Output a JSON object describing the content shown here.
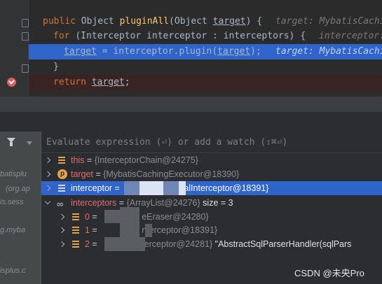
{
  "editor": {
    "lines": [
      {
        "id": "sig",
        "parts": [
          {
            "t": "public ",
            "c": "kw"
          },
          {
            "t": "Object ",
            "c": ""
          },
          {
            "t": "pluginAll",
            "c": "fn"
          },
          {
            "t": "(Object ",
            "c": ""
          },
          {
            "t": "target",
            "c": "ul"
          },
          {
            "t": ") {",
            "c": ""
          }
        ],
        "hint": "target: MybatisCachin"
      },
      {
        "id": "for",
        "parts": [
          {
            "t": "for ",
            "c": "kw"
          },
          {
            "t": "(Interceptor interceptor : interceptors) {",
            "c": ""
          }
        ],
        "hint": "interceptor:"
      },
      {
        "id": "assign",
        "parts": [
          {
            "t": "target",
            "c": "ul"
          },
          {
            "t": " = interceptor.",
            "c": ""
          },
          {
            "t": "plugin",
            "c": ""
          },
          {
            "t": "(",
            "c": ""
          },
          {
            "t": "target",
            "c": "ul"
          },
          {
            "t": ");",
            "c": ""
          }
        ],
        "hint": "target: MybatisCachi"
      },
      {
        "id": "close",
        "parts": [
          {
            "t": "}",
            "c": ""
          }
        ],
        "hint": ""
      },
      {
        "id": "return",
        "parts": [
          {
            "t": "return ",
            "c": "kw"
          },
          {
            "t": "target",
            "c": "ul"
          },
          {
            "t": ";",
            "c": ""
          }
        ],
        "hint": ""
      }
    ]
  },
  "frames": {
    "items": [
      "batisplu",
      "(org.ap",
      "is.sess",
      "g.myba",
      "isplus.c"
    ]
  },
  "evaluate": {
    "placeholder": "Evaluate expression (⏎) or add a watch (⇧⌘⏎)"
  },
  "variables": [
    {
      "key": "this",
      "name": "this",
      "eq": " = ",
      "value": "{InterceptorChain@24275}",
      "icon": "field",
      "expand": "right",
      "indent": 0
    },
    {
      "key": "target",
      "name": "target",
      "eq": " = ",
      "value": "{MybatisCachingExecutor@18390}",
      "icon": "p",
      "expand": "right",
      "indent": 0
    },
    {
      "key": "interceptor",
      "name": "interceptor",
      "eq": " = ",
      "value": "alInterceptor@18391}",
      "icon": "field-white",
      "expand": "right",
      "indent": 0,
      "selected": true
    },
    {
      "key": "interceptors",
      "name": "interceptors",
      "eq": " = ",
      "value": "{ArrayList@24276}",
      "extra": "  size = 3",
      "icon": "oo",
      "expand": "down",
      "indent": 0
    },
    {
      "key": "i0",
      "name": "0",
      "eq": " = ",
      "value": "eEraser@24280}",
      "icon": "field",
      "expand": "right",
      "indent": 1
    },
    {
      "key": "i1",
      "name": "1",
      "eq": " = ",
      "value": "nterceptor@18391}",
      "icon": "field",
      "expand": "right",
      "indent": 1
    },
    {
      "key": "i2",
      "name": "2",
      "eq": " = ",
      "value": "terceptor@24281}",
      "extra": " \"AbstractSqlParserHandler(sqlPars",
      "icon": "field",
      "expand": "right",
      "indent": 1
    }
  ],
  "watermark": "CSDN @未央Pro",
  "colors": {
    "execution_line": "#2f65ca",
    "breakpoint": "#db5c5c",
    "keyword": "#cc7832",
    "method": "#ffc66d",
    "var_name": "#e06c6c",
    "field_icon": "#e3a34b"
  }
}
